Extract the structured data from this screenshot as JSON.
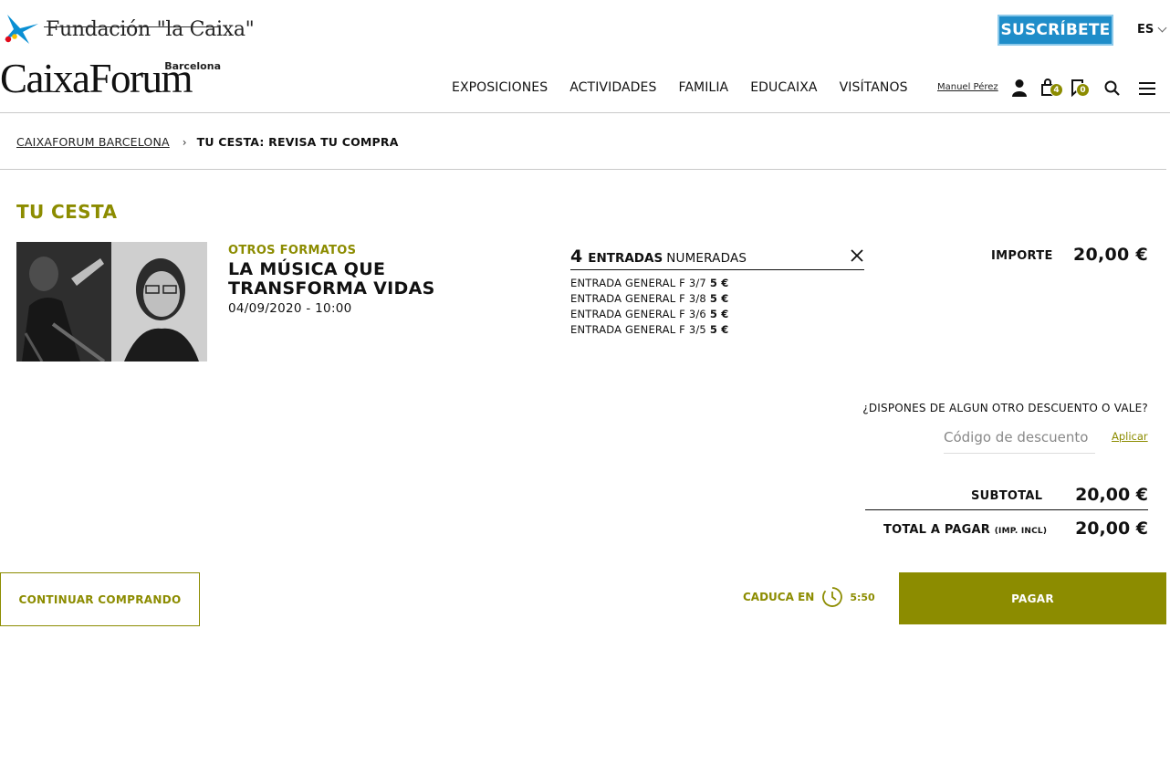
{
  "header": {
    "foundation_name": "Fundación \"la Caixa\"",
    "logo_name": "CaixaForum",
    "logo_city": "Barcelona",
    "subscribe_label": "SUSCRÍBETE",
    "language": "ES",
    "nav": [
      {
        "label": "EXPOSICIONES"
      },
      {
        "label": "ACTIVIDADES"
      },
      {
        "label": "FAMILIA"
      },
      {
        "label": "EDUCAIXA"
      },
      {
        "label": "VISÍTANOS"
      }
    ],
    "user_name": "Manuel Pérez",
    "cart_count": "4",
    "saved_count": "0",
    "icons": [
      "user-icon",
      "cart-icon",
      "bookmark-icon",
      "search-icon",
      "menu-icon"
    ]
  },
  "breadcrumb": {
    "home": "CAIXAFORUM BARCELONA",
    "separator": "›",
    "current": "TU CESTA: REVISA TU COMPRA"
  },
  "basket": {
    "title": "TU CESTA",
    "item": {
      "category": "OTROS FORMATOS",
      "title": "LA MÚSICA QUE TRANSFORMA VIDAS",
      "date": "04/09/2020 - 10:00",
      "tickets_count": "4",
      "tickets_label": "ENTRADAS",
      "tickets_type": "NUMERADAS",
      "tickets": [
        {
          "name": "ENTRADA GENERAL F 3/7",
          "price": "5 €"
        },
        {
          "name": "ENTRADA GENERAL F 3/8",
          "price": "5 €"
        },
        {
          "name": "ENTRADA GENERAL F 3/6",
          "price": "5 €"
        },
        {
          "name": "ENTRADA GENERAL F 3/5",
          "price": "5 €"
        }
      ],
      "amount_label": "IMPORTE",
      "amount": "20,00 €"
    }
  },
  "discount": {
    "question": "¿DISPONES DE ALGUN OTRO DESCUENTO O VALE?",
    "placeholder": "Código de descuento",
    "apply_label": "Aplicar"
  },
  "totals": {
    "subtotal_label": "SUBTOTAL",
    "subtotal": "20,00 €",
    "total_label": "TOTAL A PAGAR",
    "total_note": "(IMP. INCL)",
    "total": "20,00 €"
  },
  "actions": {
    "continue_label": "CONTINUAR COMPRANDO",
    "expiry_label": "CADUCA EN",
    "expiry_time": "5:50",
    "pay_label": "PAGAR"
  },
  "colors": {
    "accent": "#8c8c00",
    "subscribe": "#1f8dc9",
    "text": "#111111"
  }
}
